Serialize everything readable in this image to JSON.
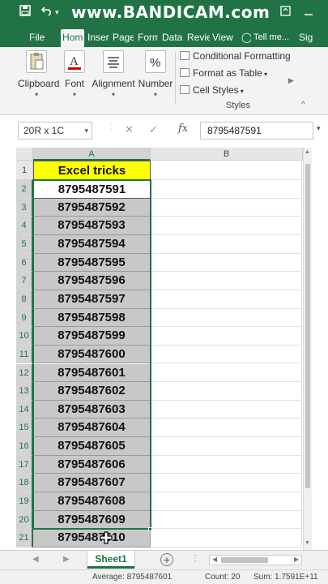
{
  "titlebar": {
    "watermark": "www.BANDICAM.com",
    "accent": "#217346"
  },
  "tabs": [
    {
      "label": "File"
    },
    {
      "label": "Hom"
    },
    {
      "label": "Inser"
    },
    {
      "label": "Page"
    },
    {
      "label": "Form"
    },
    {
      "label": "Data"
    },
    {
      "label": "Revie"
    },
    {
      "label": "View"
    },
    {
      "label": "Tell me..."
    },
    {
      "label": "Sig"
    }
  ],
  "ribbon": {
    "clipboard": "Clipboard",
    "font": "Font",
    "alignment": "Alignment",
    "number": "Number",
    "conditional_formatting": "Conditional Formatting",
    "format_as_table": "Format as Table",
    "cell_styles": "Cell Styles",
    "styles_group": "Styles"
  },
  "formula_bar": {
    "name_box": "20R x 1C",
    "fx": "fx",
    "cancel": "✕",
    "enter": "✓",
    "value": "8795487591"
  },
  "columns": [
    "A",
    "B"
  ],
  "rows": [
    {
      "num": "1",
      "value": "Excel tricks"
    },
    {
      "num": "2",
      "value": "8795487591"
    },
    {
      "num": "3",
      "value": "8795487592"
    },
    {
      "num": "4",
      "value": "8795487593"
    },
    {
      "num": "5",
      "value": "8795487594"
    },
    {
      "num": "6",
      "value": "8795487595"
    },
    {
      "num": "7",
      "value": "8795487596"
    },
    {
      "num": "8",
      "value": "8795487597"
    },
    {
      "num": "9",
      "value": "8795487598"
    },
    {
      "num": "10",
      "value": "8795487599"
    },
    {
      "num": "11",
      "value": "8795487600"
    },
    {
      "num": "12",
      "value": "8795487601"
    },
    {
      "num": "13",
      "value": "8795487602"
    },
    {
      "num": "14",
      "value": "8795487603"
    },
    {
      "num": "15",
      "value": "8795487604"
    },
    {
      "num": "16",
      "value": "8795487605"
    },
    {
      "num": "17",
      "value": "8795487606"
    },
    {
      "num": "18",
      "value": "8795487607"
    },
    {
      "num": "19",
      "value": "8795487608"
    },
    {
      "num": "20",
      "value": "8795487609"
    },
    {
      "num": "21",
      "value": "8795487610"
    }
  ],
  "sheet": {
    "tab": "Sheet1",
    "add": "+",
    "dots": "⋮"
  },
  "status": {
    "average": "Average: 8795487601",
    "count": "Count: 20",
    "sum": "Sum: 1.7591E+11"
  }
}
